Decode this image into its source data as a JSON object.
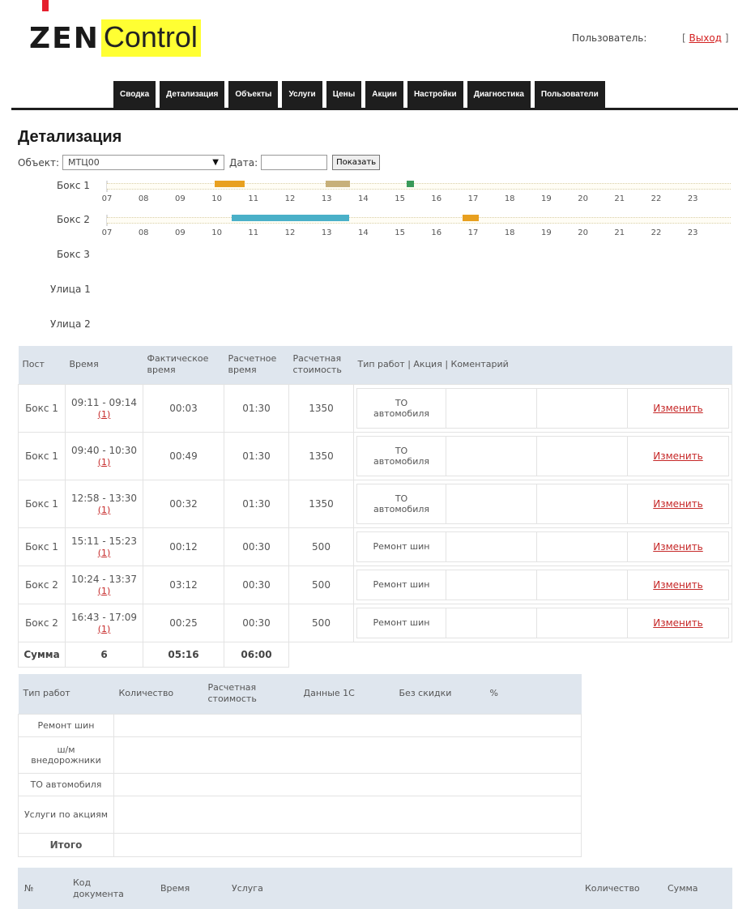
{
  "brand": {
    "logo_word1": "ZEN",
    "logo_word2": "Control",
    "accent_color": "#e5202e",
    "logo_highlight": "#ffff33"
  },
  "header": {
    "user_label": "Пользователь:",
    "logout_open": "[",
    "logout_label": "Выход",
    "logout_close": "]"
  },
  "nav": {
    "tabs": [
      "Сводка",
      "Детализация",
      "Объекты",
      "Услуги",
      "Цены",
      "Акции",
      "Настройки",
      "Диагностика",
      "Пользователи"
    ],
    "active": "Детализация"
  },
  "page": {
    "title": "Детализация"
  },
  "filter": {
    "object_label": "Объект:",
    "object_value": "МТЦ00",
    "date_label": "Дата:",
    "date_value": "",
    "show_button": "Показать"
  },
  "timeline": {
    "hours": [
      "07",
      "08",
      "09",
      "10",
      "11",
      "12",
      "13",
      "14",
      "15",
      "16",
      "17",
      "18",
      "19",
      "20",
      "21",
      "22",
      "23"
    ],
    "bar_colors": {
      "orange": "#e8a020",
      "tan": "#c7b07a",
      "teal": "#4ab0c8",
      "green": "#3a9a5a"
    },
    "posts": [
      {
        "name": "Бокс 1",
        "has_chart": true,
        "intervals": [
          {
            "start": "09:57",
            "end": "10:46",
            "color": "orange"
          },
          {
            "start": "12:58",
            "end": "13:38",
            "color": "tan"
          },
          {
            "start": "15:11",
            "end": "15:23",
            "color": "green"
          }
        ]
      },
      {
        "name": "Бокс 2",
        "has_chart": true,
        "intervals": [
          {
            "start": "10:24",
            "end": "13:37",
            "color": "teal"
          },
          {
            "start": "16:43",
            "end": "17:09",
            "color": "orange"
          }
        ]
      },
      {
        "name": "Бокс 3",
        "has_chart": false,
        "intervals": []
      },
      {
        "name": "Улица 1",
        "has_chart": false,
        "intervals": []
      },
      {
        "name": "Улица 2",
        "has_chart": false,
        "intervals": []
      }
    ]
  },
  "details": {
    "headers": [
      "Пост",
      "Время",
      "Фактическое время",
      "Расчетное время",
      "Расчетная стоимость",
      "Тип работ | Акция | Коментарий"
    ],
    "rows": [
      {
        "post": "Бокс 1",
        "time": "09:11 - 09:14",
        "count": "(1)",
        "actual": "00:03",
        "estimated": "01:30",
        "cost": "1350",
        "work": "ТО автомобиля",
        "promo": "",
        "comment": "",
        "edit": "Изменить"
      },
      {
        "post": "Бокс 1",
        "time": "09:40 - 10:30",
        "count": "(1)",
        "actual": "00:49",
        "estimated": "01:30",
        "cost": "1350",
        "work": "ТО автомобиля",
        "promo": "",
        "comment": "",
        "edit": "Изменить"
      },
      {
        "post": "Бокс 1",
        "time": "12:58 - 13:30",
        "count": "(1)",
        "actual": "00:32",
        "estimated": "01:30",
        "cost": "1350",
        "work": "ТО автомобиля",
        "promo": "",
        "comment": "",
        "edit": "Изменить"
      },
      {
        "post": "Бокс 1",
        "time": "15:11 - 15:23",
        "count": "(1)",
        "actual": "00:12",
        "estimated": "00:30",
        "cost": "500",
        "work": "Ремонт шин",
        "promo": "",
        "comment": "",
        "edit": "Изменить"
      },
      {
        "post": "Бокс 2",
        "time": "10:24 - 13:37",
        "count": "(1)",
        "actual": "03:12",
        "estimated": "00:30",
        "cost": "500",
        "work": "Ремонт шин",
        "promo": "",
        "comment": "",
        "edit": "Изменить"
      },
      {
        "post": "Бокс 2",
        "time": "16:43 - 17:09",
        "count": "(1)",
        "actual": "00:25",
        "estimated": "00:30",
        "cost": "500",
        "work": "Ремонт шин",
        "promo": "",
        "comment": "",
        "edit": "Изменить"
      }
    ],
    "sum": {
      "label": "Сумма",
      "count": "6",
      "actual": "05:16",
      "estimated": "06:00"
    }
  },
  "work_types": {
    "headers": [
      "Тип работ",
      "Количество",
      "Расчетная стоимость",
      "Данные 1С",
      "Без скидки",
      "%"
    ],
    "rows": [
      {
        "name": "Ремонт шин",
        "highlight": true
      },
      {
        "name": "ш/м внедорожники",
        "highlight": false
      },
      {
        "name": "ТО автомобиля",
        "highlight": true
      },
      {
        "name": "Услуги по акциям",
        "highlight": false
      }
    ],
    "total_label": "Итого"
  },
  "documents": {
    "headers": [
      "№",
      "Код документа",
      "Время",
      "Услуга",
      "Количество",
      "Сумма"
    ]
  }
}
